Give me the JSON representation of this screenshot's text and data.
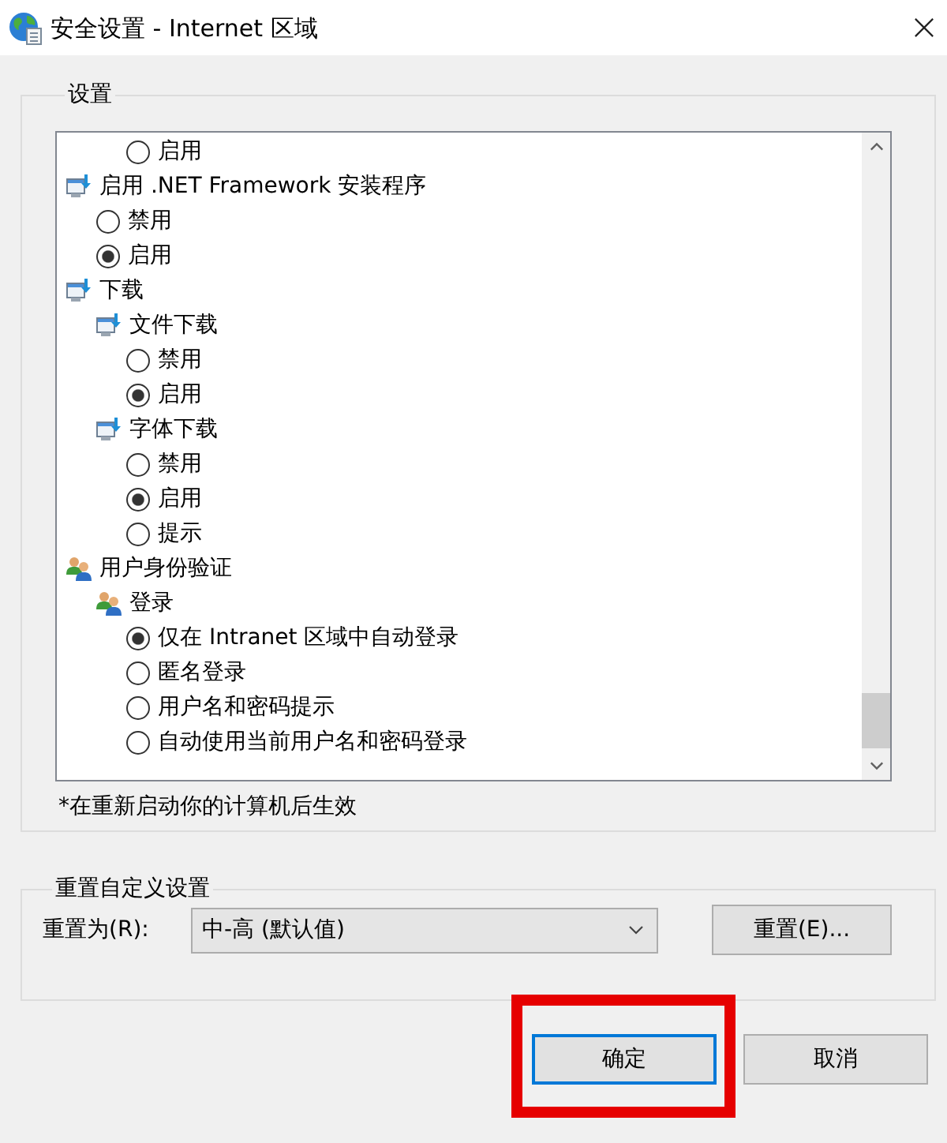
{
  "window": {
    "title": "安全设置 - Internet 区域"
  },
  "settings_group": {
    "title": "设置",
    "continued_options": [
      {
        "kind": "option",
        "label": "启用",
        "selected": false
      }
    ],
    "items": [
      {
        "kind": "setting",
        "label": "启用 .NET Framework 安装程序",
        "children": [
          {
            "kind": "option",
            "label": "禁用",
            "selected": false
          },
          {
            "kind": "option",
            "label": "启用",
            "selected": true
          }
        ]
      },
      {
        "kind": "setting",
        "label": "下载",
        "children": [
          {
            "kind": "setting",
            "label": "文件下载",
            "children": [
              {
                "kind": "option",
                "label": "禁用",
                "selected": false
              },
              {
                "kind": "option",
                "label": "启用",
                "selected": true
              }
            ]
          },
          {
            "kind": "setting",
            "label": "字体下载",
            "children": [
              {
                "kind": "option",
                "label": "禁用",
                "selected": false
              },
              {
                "kind": "option",
                "label": "启用",
                "selected": true
              },
              {
                "kind": "option",
                "label": "提示",
                "selected": false
              }
            ]
          }
        ]
      },
      {
        "kind": "account",
        "label": "用户身份验证",
        "children": [
          {
            "kind": "account",
            "label": "登录",
            "children": [
              {
                "kind": "option",
                "label": "仅在 Intranet 区域中自动登录",
                "selected": true
              },
              {
                "kind": "option",
                "label": "匿名登录",
                "selected": false
              },
              {
                "kind": "option",
                "label": "用户名和密码提示",
                "selected": false
              },
              {
                "kind": "option",
                "label": "自动使用当前用户名和密码登录",
                "selected": false
              }
            ]
          }
        ]
      }
    ],
    "note": "*在重新启动你的计算机后生效"
  },
  "reset_group": {
    "title": "重置自定义设置",
    "label": "重置为(R):",
    "dropdown": {
      "value": "中-高 (默认值)"
    },
    "button": "重置(E)..."
  },
  "buttons": [
    {
      "label": "确定",
      "default": true,
      "highlighted": true
    },
    {
      "label": "取消",
      "default": false,
      "highlighted": false
    }
  ]
}
